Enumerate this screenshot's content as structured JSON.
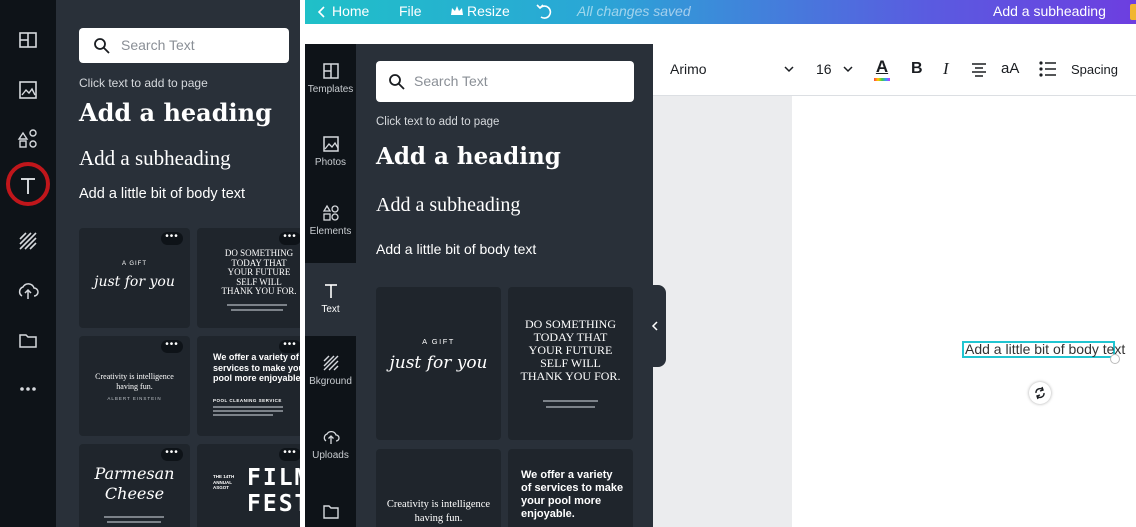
{
  "left_panel": {
    "search_placeholder": "Search Text",
    "hint": "Click text to add to page",
    "heading": "Add a heading",
    "subheading": "Add a subheading",
    "body_text": "Add a little bit of body text",
    "more_label": "•••",
    "cards": {
      "gift_small": "A GIFT",
      "gift_script": "just for you",
      "quote_lines": [
        "DO SOMETHING",
        "TODAY THAT",
        "YOUR FUTURE",
        "SELF WILL",
        "THANK YOU FOR."
      ],
      "creativity": "Creativity is intelligence having fun.",
      "creativity_author": "ALBERT EINSTEIN",
      "services": "We offer a variety of services to make your pool more enjoyable.",
      "services_sub": "POOL CLEANING SERVICE",
      "parmesan_1": "Parmesan",
      "parmesan_2": "Cheese",
      "film_small_1": "THE 14TH",
      "film_small_2": "ANNUAL",
      "film_small_3": "ASGOT",
      "film_1": "FILM",
      "film_2": "FEST"
    }
  },
  "topbar": {
    "home": "Home",
    "file": "File",
    "resize": "Resize",
    "saved": "All changes saved",
    "title": "Add a subheading"
  },
  "sidebar": {
    "items": [
      {
        "label": "Templates"
      },
      {
        "label": "Photos"
      },
      {
        "label": "Elements"
      },
      {
        "label": "Text"
      },
      {
        "label": "Bkground"
      },
      {
        "label": "Uploads"
      }
    ]
  },
  "right_panel": {
    "search_placeholder": "Search Text",
    "hint": "Click text to add to page",
    "heading": "Add a heading",
    "subheading": "Add a subheading",
    "body_text": "Add a little bit of body text",
    "cards": {
      "gift_small": "A GIFT",
      "gift_script": "just for you",
      "quote_lines": [
        "DO SOMETHING",
        "TODAY THAT",
        "YOUR FUTURE",
        "SELF WILL",
        "THANK YOU FOR."
      ],
      "creativity_1": "Creativity is intelligence",
      "creativity_2": "having fun.",
      "services_1": "We offer a variety",
      "services_2": "of services to make",
      "services_3": "your pool more",
      "services_4": "enjoyable."
    }
  },
  "toolbar": {
    "font": "Arimo",
    "font_size": "16",
    "bold": "B",
    "italic": "I",
    "case": "aA",
    "spacing": "Spacing",
    "text_color_letter": "A"
  },
  "canvas": {
    "selected_text": "Add a little bit of body text"
  },
  "colors": {
    "accent": "#21c5d1",
    "highlight_ring": "#c0161b",
    "panel": "#293039",
    "rail": "#0e1318"
  }
}
